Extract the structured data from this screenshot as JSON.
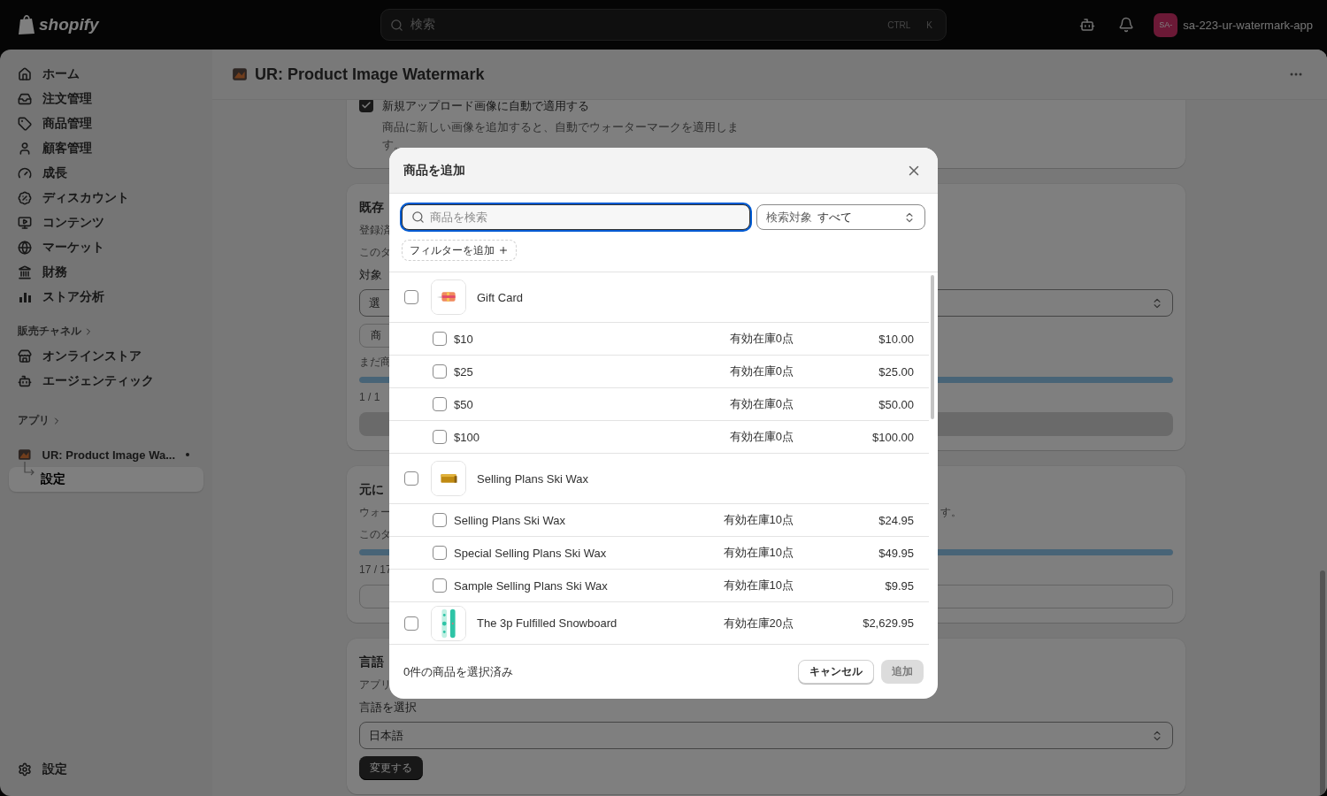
{
  "topbar": {
    "logo": "shopify",
    "search": {
      "placeholder": "検索",
      "keys": [
        "CTRL",
        "K"
      ]
    },
    "avatar": {
      "initials": "SA-",
      "store": "sa-223-ur-watermark-app"
    }
  },
  "sidebar": {
    "nav": [
      {
        "label": "ホーム",
        "selected": false
      },
      {
        "label": "注文管理",
        "selected": false
      },
      {
        "label": "商品管理",
        "selected": false
      },
      {
        "label": "顧客管理",
        "selected": false
      },
      {
        "label": "成長",
        "selected": false
      },
      {
        "label": "ディスカウント",
        "selected": false
      },
      {
        "label": "コンテンツ",
        "selected": false
      },
      {
        "label": "マーケット",
        "selected": false
      },
      {
        "label": "財務",
        "selected": false
      },
      {
        "label": "ストア分析",
        "selected": false
      }
    ],
    "channels": {
      "heading": "販売チャネル",
      "items": [
        {
          "label": "オンラインストア",
          "selected": false
        },
        {
          "label": "エージェンティック",
          "selected": false
        }
      ]
    },
    "apps": {
      "heading": "アプリ",
      "items": [
        {
          "label": "UR: Product Image Wa...",
          "selected": false,
          "pinned": true,
          "children": [
            {
              "label": "設定",
              "selected": true
            }
          ]
        }
      ]
    },
    "footer": {
      "label": "設定",
      "selected": false
    }
  },
  "page": {
    "title": "UR: Product Image Watermark",
    "cards": [
      {
        "blocks": [
          {
            "kind": "checkbox",
            "label": "新規アップロード画像に自動で適用する",
            "checked": true,
            "description": "商品に新しい画像を追加すると、自動でウォーターマークを適用します。"
          }
        ]
      },
      {
        "blocks": [
          {
            "kind": "title",
            "text": "既存"
          },
          {
            "kind": "text",
            "text": "登録済"
          },
          {
            "kind": "text",
            "text": "このタ"
          },
          {
            "kind": "label",
            "text": "対象"
          },
          {
            "kind": "select",
            "text": "選"
          },
          {
            "kind": "button",
            "text": "商"
          },
          {
            "kind": "text",
            "text": "まだ商"
          },
          {
            "kind": "progress",
            "level": 1
          },
          {
            "kind": "text",
            "text": "1 / 1"
          },
          {
            "kind": "bar_button",
            "disabled": true
          }
        ]
      },
      {
        "blocks": [
          {
            "kind": "title",
            "text": "元に"
          },
          {
            "kind": "split",
            "text": "ウォー",
            "tail": "す。"
          },
          {
            "kind": "text",
            "text": "このタ"
          },
          {
            "kind": "progress",
            "level": 1
          },
          {
            "kind": "text",
            "text": "17 / 17"
          },
          {
            "kind": "bar_button",
            "disabled": false
          }
        ]
      },
      {
        "blocks": [
          {
            "kind": "title",
            "text": "言語"
          },
          {
            "kind": "text",
            "text": "アプリ"
          },
          {
            "kind": "label",
            "text": "言語を選択"
          },
          {
            "kind": "select",
            "text": "日本語"
          },
          {
            "kind": "primary_button",
            "text": "変更する"
          }
        ]
      }
    ]
  },
  "modal": {
    "title": "商品を追加",
    "search": {
      "placeholder": "商品を検索",
      "focused": true
    },
    "scope": {
      "label": "検索対象",
      "value": "すべて"
    },
    "filter_button": "フィルターを追加",
    "rows": [
      {
        "kind": "product",
        "name": "Gift Card",
        "checked": false
      },
      {
        "kind": "variant",
        "name": "$10",
        "stock": "有効在庫0点",
        "price": "$10.00",
        "checked": false
      },
      {
        "kind": "variant",
        "name": "$25",
        "stock": "有効在庫0点",
        "price": "$25.00",
        "checked": false
      },
      {
        "kind": "variant",
        "name": "$50",
        "stock": "有効在庫0点",
        "price": "$50.00",
        "checked": false
      },
      {
        "kind": "variant",
        "name": "$100",
        "stock": "有効在庫0点",
        "price": "$100.00",
        "checked": false
      },
      {
        "kind": "product",
        "name": "Selling Plans Ski Wax",
        "checked": false
      },
      {
        "kind": "variant",
        "name": "Selling Plans Ski Wax",
        "stock": "有効在庫10点",
        "price": "$24.95",
        "checked": false
      },
      {
        "kind": "variant",
        "name": "Special Selling Plans Ski Wax",
        "stock": "有効在庫10点",
        "price": "$49.95",
        "checked": false
      },
      {
        "kind": "variant",
        "name": "Sample Selling Plans Ski Wax",
        "stock": "有効在庫10点",
        "price": "$9.95",
        "checked": false
      },
      {
        "kind": "product",
        "name": "The 3p Fulfilled Snowboard",
        "stock": "有効在庫20点",
        "price": "$2,629.95",
        "checked": false
      }
    ],
    "footer": {
      "selection": "0件の商品を選択済み",
      "buttons": [
        {
          "label": "キャンセル",
          "disabled": false
        },
        {
          "label": "追加",
          "disabled": true
        }
      ]
    }
  }
}
